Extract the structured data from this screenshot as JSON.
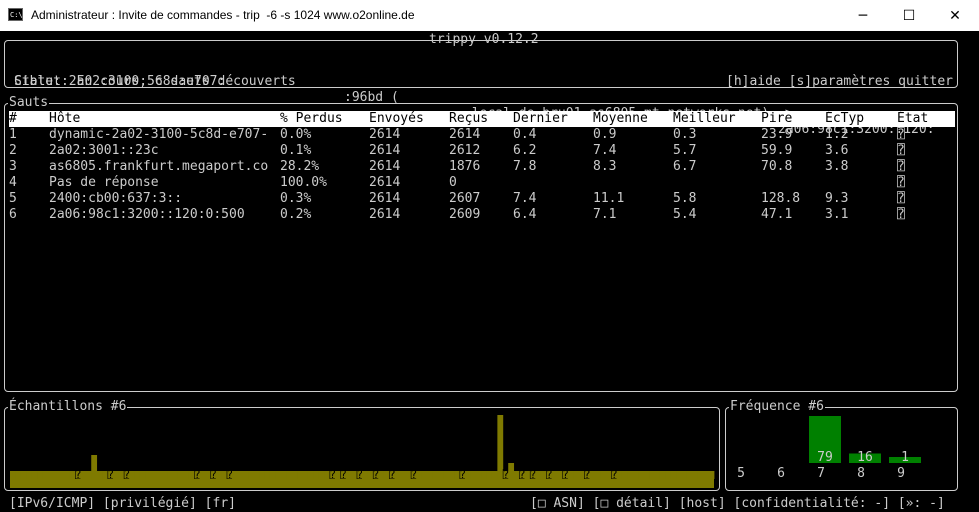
{
  "window": {
    "title": "Administrateur : Invite de commandes - trip  -6 -s 1024 www.o2online.de",
    "app_icon_text": "C:\\",
    "minimize": "─",
    "maximize": "☐",
    "close": "✕"
  },
  "header": {
    "app": "trippy v0.12.2",
    "target_a": "Cible: 2a02:3100:5c8d:e707:",
    "target_b": ":96bd (",
    "target_c": ".local.de-bru01-as6805.mt-networks.net) ->",
    "target_d": "2a06:98c1:3200::120:",
    "status": "Statut: En cours, 6 sauts découverts",
    "keys": "[h]aide [s]paramètres quitter"
  },
  "hops": {
    "label": "Sauts",
    "columns": [
      "#",
      "Hôte",
      "% Perdus",
      "Envoyés",
      "Reçus",
      "Dernier",
      "Moyenne",
      "Meilleur",
      "Pire",
      "ÉcTyp",
      "État"
    ],
    "rows": [
      {
        "no": "1",
        "host": "dynamic-2a02-3100-5c8d-e707-",
        "loss": "0.0%",
        "snd": "2614",
        "rcv": "2614",
        "last": "0.4",
        "avg": "0.9",
        "best": "0.3",
        "wrst": "23.9",
        "stdev": "1.2",
        "state": "⍰"
      },
      {
        "no": "2",
        "host": "2a02:3001::23c",
        "loss": "0.1%",
        "snd": "2614",
        "rcv": "2612",
        "last": "6.2",
        "avg": "7.4",
        "best": "5.7",
        "wrst": "59.9",
        "stdev": "3.6",
        "state": "⍰"
      },
      {
        "no": "3",
        "host": "as6805.frankfurt.megaport.co",
        "loss": "28.2%",
        "snd": "2614",
        "rcv": "1876",
        "last": "7.8",
        "avg": "8.3",
        "best": "6.7",
        "wrst": "70.8",
        "stdev": "3.8",
        "state": "⍰"
      },
      {
        "no": "4",
        "host": "Pas de réponse",
        "loss": "100.0%",
        "snd": "2614",
        "rcv": "0",
        "last": "",
        "avg": "",
        "best": "",
        "wrst": "",
        "stdev": "",
        "state": "⍰"
      },
      {
        "no": "5",
        "host": "2400:cb00:637:3::",
        "loss": "0.3%",
        "snd": "2614",
        "rcv": "2607",
        "last": "7.4",
        "avg": "11.1",
        "best": "5.8",
        "wrst": "128.8",
        "stdev": "9.3",
        "state": "⍰"
      },
      {
        "no": "6",
        "host": "2a06:98c1:3200::120:0:500",
        "loss": "0.2%",
        "snd": "2614",
        "rcv": "2609",
        "last": "6.4",
        "avg": "7.1",
        "best": "5.4",
        "wrst": "47.1",
        "stdev": "3.1",
        "state": "⍰"
      }
    ]
  },
  "samples": {
    "label": "Échantillons #6",
    "colors": {
      "bar": "#7f7a00",
      "glyph": "#000000"
    },
    "glyph": "⍰",
    "missing_value": -1,
    "values": [
      1,
      1,
      1,
      1,
      1,
      1,
      1,
      1,
      1,
      1,
      1,
      1,
      -1,
      1,
      1,
      3,
      1,
      1,
      -1,
      1,
      1,
      -1,
      1,
      1,
      1,
      1,
      1,
      1,
      1,
      1,
      1,
      1,
      1,
      1,
      -1,
      1,
      1,
      -1,
      1,
      1,
      -1,
      1,
      1,
      1,
      1,
      1,
      1,
      1,
      1,
      1,
      1,
      1,
      1,
      1,
      1,
      1,
      1,
      1,
      1,
      -1,
      1,
      -1,
      1,
      1,
      -1,
      1,
      1,
      -1,
      1,
      1,
      -1,
      1,
      1,
      1,
      -1,
      1,
      1,
      1,
      1,
      1,
      1,
      1,
      1,
      -1,
      1,
      1,
      1,
      1,
      1,
      1,
      8,
      -1,
      2,
      1,
      -1,
      1,
      -1,
      1,
      1,
      -1,
      1,
      1,
      -1,
      1,
      1,
      1,
      -1,
      1,
      1,
      1,
      1,
      -1,
      1,
      1,
      1,
      1,
      1,
      1,
      1,
      1,
      1,
      1,
      1,
      1,
      1,
      1,
      1,
      1,
      1,
      1
    ]
  },
  "frequency": {
    "label": "Fréquence #6",
    "colors": {
      "bar": "#008000"
    },
    "bins": [
      {
        "x": "5",
        "count": 0
      },
      {
        "x": "6",
        "count": 79
      },
      {
        "x": "7",
        "count": 16
      },
      {
        "x": "8",
        "count": 1
      },
      {
        "x": "9",
        "count": 0
      }
    ]
  },
  "footer": {
    "left": "[IPv6/ICMP] [privilégié] [fr]",
    "right": "[□ ASN] [□ détail] [host] [confidentialité: -] [»: -]"
  }
}
